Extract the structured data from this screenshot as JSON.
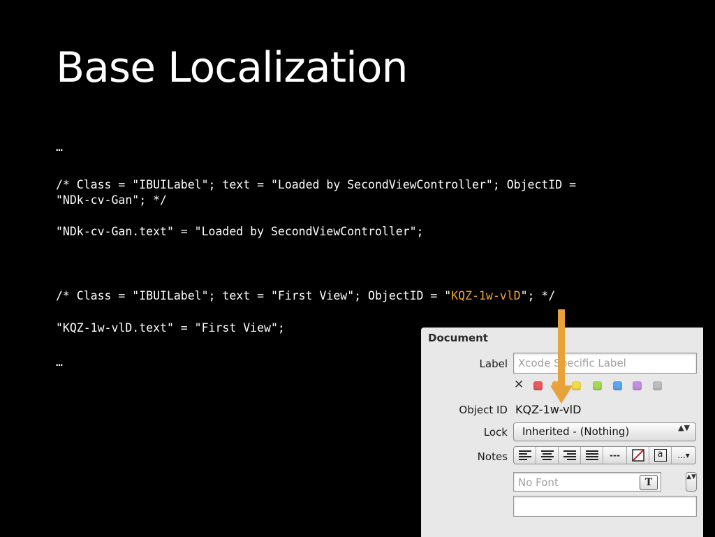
{
  "slide": {
    "title": "Base Localization",
    "code": {
      "line1": "…",
      "line2": "/* Class = \"IBUILabel\"; text = \"Loaded by SecondViewController\"; ObjectID =",
      "line3": "\"NDk-cv-Gan\"; */",
      "line4": "\"NDk-cv-Gan.text\" = \"Loaded by SecondViewController\";",
      "line5_pre": "/* Class = \"IBUILabel\"; text = \"First View\"; ObjectID = \"",
      "line5_hl": "KQZ-1w-vlD",
      "line5_post": "\"; */",
      "line6": "\"KQZ-1w-vlD.text\" = \"First View\";",
      "line7": "…"
    }
  },
  "inspector": {
    "heading": "Document",
    "label_label": "Label",
    "label_placeholder": "Xcode Specific Label",
    "close_glyph": "✕",
    "swatch_colors": [
      "#e85a5a",
      "#f2a43a",
      "#f0dc4a",
      "#a6d94f",
      "#5aa7f0",
      "#c58ee6",
      "#bdbdbd"
    ],
    "object_id_label": "Object ID",
    "object_id_value": "KQZ-1w-vlD",
    "lock_label": "Lock",
    "lock_value": "Inherited - (Nothing)",
    "lock_arrows": "▲▼",
    "notes_label": "Notes",
    "notes_dash": "---",
    "notes_a": "a",
    "notes_more": "...▾",
    "font_placeholder": "No Font",
    "font_badge": "T",
    "stepper_arrows": "▲▼"
  },
  "colors": {
    "background": "#000000",
    "text": "#ffffff",
    "highlight": "#f0a535",
    "arrow": "#e8a23a"
  }
}
